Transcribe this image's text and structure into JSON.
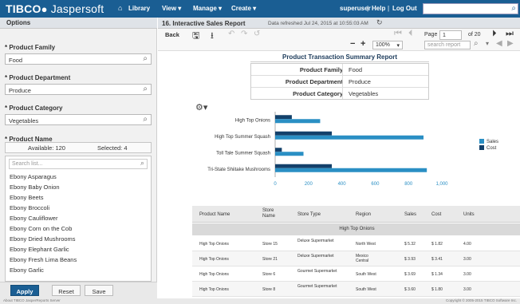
{
  "app": {
    "logo_main": "TIBCO",
    "logo_rest": "Jaspersoft",
    "nav_library": "Library",
    "nav_view": "View ▾",
    "nav_manage": "Manage ▾",
    "nav_create": "Create ▾",
    "user": "superuser",
    "help": "Help",
    "logout": "Log Out",
    "sep": "|"
  },
  "left": {
    "title": "Options",
    "family_label": "* Product Family",
    "family_value": "Food",
    "department_label": "* Product Department",
    "department_value": "Produce",
    "category_label": "* Product Category",
    "category_value": "Vegetables",
    "name_label": "* Product Name",
    "tab_available": "Available: 120",
    "tab_selected": "Selected: 4",
    "list_search_placeholder": "Search list...",
    "items": [
      "Ebony Asparagus",
      "Ebony Baby Onion",
      "Ebony Beets",
      "Ebony Broccoli",
      "Ebony Cauliflower",
      "Ebony Corn on the Cob",
      "Ebony Dried Mushrooms",
      "Ebony Elephant Garlic",
      "Ebony Fresh Lima Beans",
      "Ebony Garlic"
    ],
    "apply": "Apply",
    "reset": "Reset",
    "save": "Save"
  },
  "report": {
    "title": "16. Interactive Sales Report",
    "refreshed": "Data refreshed Jul 24, 2015 at 10:55:03 AM",
    "back": "Back",
    "zoom": "100%",
    "page_label": "Page",
    "page_value": "1",
    "page_of": "of 20",
    "search_placeholder": "search report",
    "summary_title": "Product Transaction Summary Report",
    "summary": [
      {
        "label": "Product Family",
        "value": "Food"
      },
      {
        "label": "Product Department",
        "value": "Produce"
      },
      {
        "label": "Product Category",
        "value": "Vegetables"
      }
    ],
    "columns": [
      "Product Name",
      "Store Name",
      "Store Type",
      "Region",
      "Sales",
      "Cost",
      "Units"
    ],
    "group_header": "High Top Onions",
    "rows": [
      [
        "High Top Onions",
        "Store 15",
        "Deluxe Supermarket",
        "North West",
        "$ 5.32",
        "$ 1.82",
        "4.00"
      ],
      [
        "High Top Onions",
        "Store 21",
        "Deluxe Supermarket",
        "Mexico Central",
        "$ 3.93",
        "$ 3.41",
        "3.00"
      ],
      [
        "High Top Onions",
        "Store 6",
        "Gourmet Supermarket",
        "South West",
        "$ 3.69",
        "$ 1.34",
        "3.00"
      ],
      [
        "High Top Onions",
        "Store 8",
        "Gourmet Supermarket",
        "South West",
        "$ 3.60",
        "$ 1.80",
        "3.00"
      ]
    ]
  },
  "chart_data": {
    "type": "bar",
    "orientation": "horizontal",
    "categories": [
      "High Top Onions",
      "High Top Summer Squash",
      "Toll Tale Summer Squash",
      "Tri-State Shiitake Mushrooms"
    ],
    "series": [
      {
        "name": "Sales",
        "color": "#2a8fc4",
        "values": [
          270,
          890,
          170,
          910
        ]
      },
      {
        "name": "Cost",
        "color": "#13406a",
        "values": [
          100,
          340,
          40,
          340
        ]
      }
    ],
    "xticks": [
      "0",
      "200",
      "400",
      "600",
      "800",
      "1,000"
    ],
    "xlim": [
      0,
      1000
    ],
    "legend": "right"
  },
  "status": {
    "left": "About TIBCO JasperReports Server",
    "right": "Copyright © 2005-2015 TIBCO Software Inc."
  },
  "colors": {
    "brand": "#1a5e93",
    "sales": "#2a8fc4",
    "cost": "#13406a"
  }
}
